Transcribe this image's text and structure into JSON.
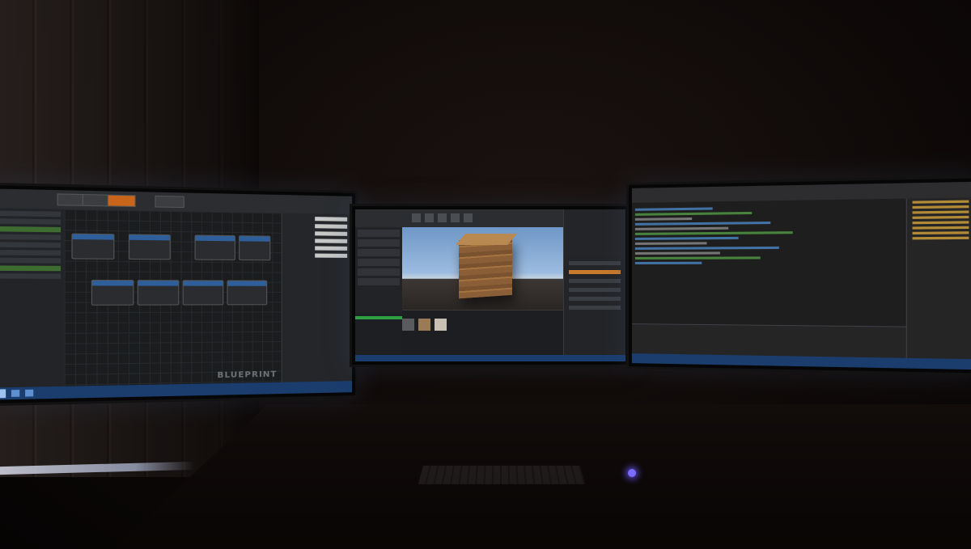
{
  "scene": {
    "description_visible_text": {
      "left_monitor_watermark": "BLUEPRINT"
    }
  },
  "colors": {
    "room": "#0b0706",
    "editor_panel": "#1e1f22",
    "taskbar": "#1a3d6e",
    "blueprint_node_header": "#2e5f9a",
    "sky": "#9cbce0",
    "crate_wood": "#966a3c",
    "pc_led": "#7c6cff"
  },
  "icons": {
    "start": "windows-start-icon",
    "led": "power-led-icon"
  }
}
